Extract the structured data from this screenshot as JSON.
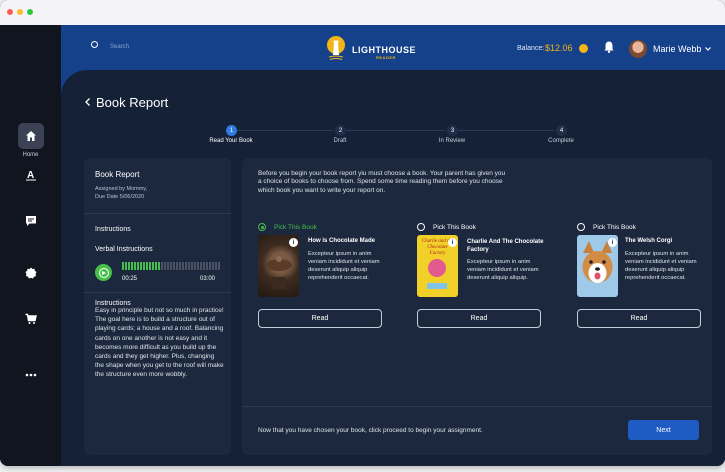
{
  "header": {
    "search_placeholder": "Search",
    "logo_title": "LIGHTHOUSE",
    "logo_subtitle": "READER",
    "balance_label": "Balance:",
    "balance_value": "$12.06",
    "user_name": "Marie Webb"
  },
  "sidebar": {
    "items": [
      {
        "icon": "home-icon",
        "label": "Home",
        "active": true
      },
      {
        "icon": "text-format-icon",
        "label": ""
      },
      {
        "icon": "message-icon",
        "label": ""
      },
      {
        "icon": "badge-icon",
        "label": ""
      },
      {
        "icon": "cart-icon",
        "label": ""
      },
      {
        "icon": "more-icon",
        "label": ""
      }
    ]
  },
  "page": {
    "title": "Book Report"
  },
  "steps": [
    {
      "number": "1",
      "label": "Read Your Book",
      "active": true
    },
    {
      "number": "2",
      "label": "Draft",
      "active": false
    },
    {
      "number": "3",
      "label": "In Review",
      "active": false
    },
    {
      "number": "4",
      "label": "Complete",
      "active": false
    }
  ],
  "assignment": {
    "title": "Book Report",
    "assigned_by": "Assigned by Mommy,",
    "due_date": "Due Date 5/06/2020",
    "instructions_heading": "Instructions",
    "verbal_heading": "Verbal Instructions",
    "time_elapsed": "00:25",
    "time_total": "03:00",
    "audio_progress": 0.14,
    "instructions_heading2": "Instructions",
    "instructions_text": "Easy in principle but not so much in practice! The goal here is to build a structure out of playing cards; a house and a roof. Balancing cards on one another is not easy and it becomes more difficult as you build up the cards and they get higher. Plus, changing the shape when you get to the roof will make the structure even more wobbly."
  },
  "books_panel": {
    "intro": "Before you begin your book report yiu must choose a book. Your parent has given you a choice of books to choose from. Spend some time reading them before you choose which book you want to write your report on.",
    "books": [
      {
        "pick_label": "Pick This Book",
        "selected": true,
        "title": "How is Chocolate Made",
        "description": "Excepteur ipsum in anim veniam incididunt et veniam deserunt aliquip aliquip reprehenderit occaecat.",
        "read_label": "Read"
      },
      {
        "pick_label": "Pick This Book",
        "selected": false,
        "title": "Charlie And The Chocolate Factory",
        "description": "Excepteur ipsum in anim veniam incididunt et veniam deserunt aliquip aliquip.",
        "read_label": "Read",
        "cover_text": "Charlie and the Chocolate Factory"
      },
      {
        "pick_label": "Pick This Book",
        "selected": false,
        "title": "The Welsh Corgi",
        "description": "Excepteur ipsum in anim veniam incididunt et veniam deserunt aliquip aliquip reprehenderit occaecat.",
        "read_label": "Read"
      }
    ],
    "footer_text": "Now that you have chosen your book, click proceed to begin your assignment.",
    "next_label": "Next"
  },
  "colors": {
    "accent_blue": "#1e5cc4",
    "header_blue": "#15408a",
    "success_green": "#46c04b",
    "balance_gold": "#f2b417"
  }
}
